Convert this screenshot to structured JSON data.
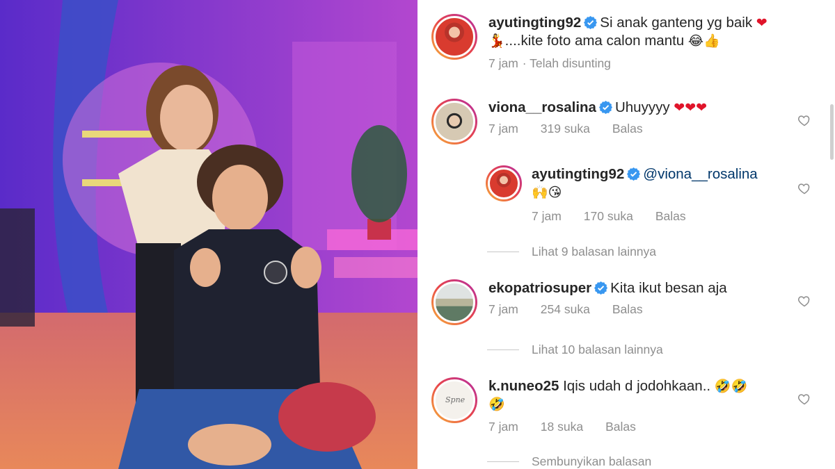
{
  "post": {
    "author": "ayutingting92",
    "caption_line1": "Si anak ganteng yg baik",
    "caption_line1_emoji": "❤",
    "caption_line2_emoji_lead": "💃",
    "caption_line2": "....kite foto ama calon mantu",
    "caption_line2_emoji_tail": "😂👍",
    "time": "7 jam",
    "edited": "· Telah disunting"
  },
  "comments": [
    {
      "user": "viona__rosalina",
      "text": "Uhuyyyy",
      "emoji": "❤❤❤",
      "time": "7 jam",
      "likes": "319 suka",
      "reply_label": "Balas",
      "reply": {
        "user": "ayutingting92",
        "mention": "@viona__rosalina",
        "emoji": "🙌😘",
        "time": "7 jam",
        "likes": "170 suka",
        "reply_label": "Balas"
      },
      "view_replies": "Lihat 9 balasan lainnya"
    },
    {
      "user": "ekopatriosuper",
      "text": "Kita ikut besan aja",
      "time": "7 jam",
      "likes": "254 suka",
      "reply_label": "Balas",
      "view_replies": "Lihat 10 balasan lainnya"
    },
    {
      "user": "k.nuneo25",
      "text": "Iqis udah d jodohkaan..",
      "emoji": "🤣🤣",
      "emoji_line2": "🤣",
      "time": "7 jam",
      "likes": "18 suka",
      "reply_label": "Balas",
      "view_replies": "Sembunyikan balasan"
    }
  ],
  "icons": {
    "verified": "verified-badge-icon",
    "heart": "heart-outline-icon"
  },
  "colors": {
    "verified": "#3897f0",
    "meta_text": "#8e8e8e",
    "mention": "#00376b"
  }
}
